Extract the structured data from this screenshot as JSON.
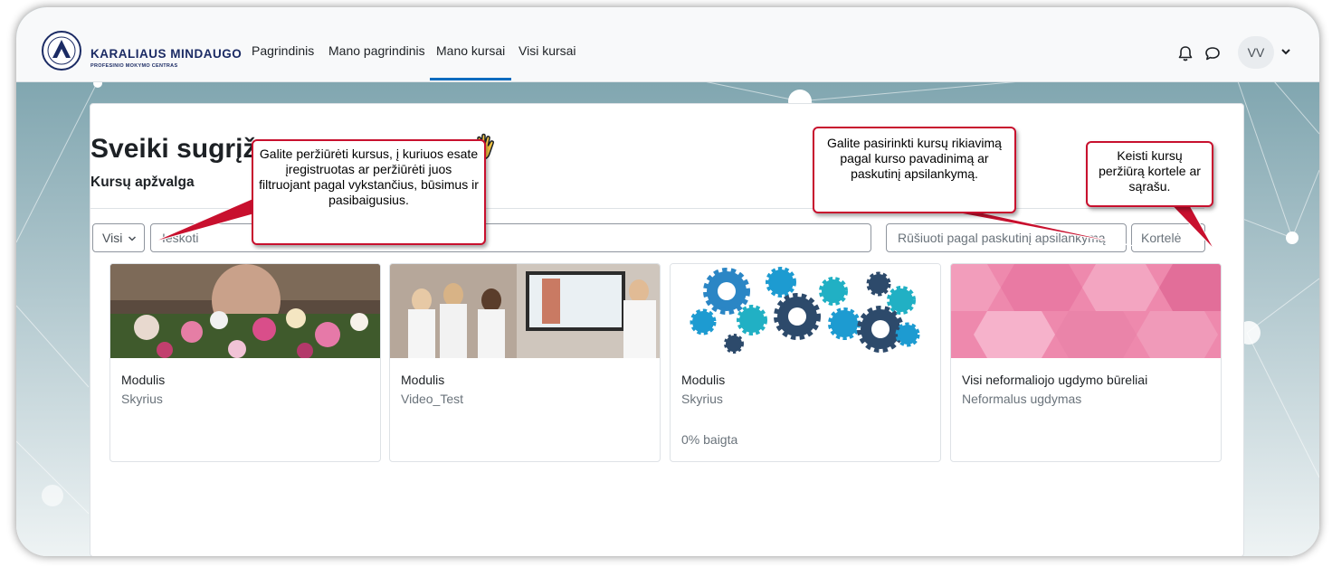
{
  "brand": {
    "name": "KARALIAUS MINDAUGO",
    "subtitle": "PROFESINIO MOKYMO CENTRAS"
  },
  "nav": {
    "links": [
      "Pagrindinis",
      "Mano pagrindinis",
      "Mano kursai",
      "Visi kursai"
    ],
    "active": "Mano kursai"
  },
  "user": {
    "initials": "VV"
  },
  "page": {
    "greeting": "Sveiki sugrįžę",
    "overview_title": "Kursų apžvalga"
  },
  "controls": {
    "filter_label": "Visi",
    "search_placeholder": "Ieškoti",
    "sort_label": "Rūšiuoti pagal paskutinį apsilankymą",
    "view_label": "Kortelė"
  },
  "courses": [
    {
      "category": "Modulis",
      "name": "Skyrius",
      "progress": "",
      "image": "flowers-photo"
    },
    {
      "category": "Modulis",
      "name": "Video_Test",
      "progress": "",
      "image": "classroom-photo"
    },
    {
      "category": "Modulis",
      "name": "Skyrius",
      "progress": "0% baigta",
      "image": "gears-illustration"
    },
    {
      "category": "Visi neformaliojo ugdymo būreliai",
      "name": "Neformalus ugdymas",
      "progress": "",
      "image": "pink-hexagon-pattern"
    }
  ],
  "callouts": {
    "filter_hint": "Galite peržiūrėti kursus, į kuriuos esate įregistruotas ar peržiūrėti juos filtruojant pagal vykstančius, būsimus ir pasibaigusius.",
    "sort_hint": "Galite pasirinkti kursų rikiavimą pagal kurso pavadinimą ar paskutinį apsilankymą.",
    "view_hint": "Keisti kursų peržiūrą kortele ar sąrašu."
  },
  "colors": {
    "accent": "#0f6cbf",
    "callout_border": "#c8102e",
    "background_teal": "#6c9aa6",
    "brand_navy": "#1b2b64"
  },
  "icons": [
    "bell-icon",
    "chat-icon",
    "chevron-down-icon",
    "wave-hand-icon"
  ]
}
